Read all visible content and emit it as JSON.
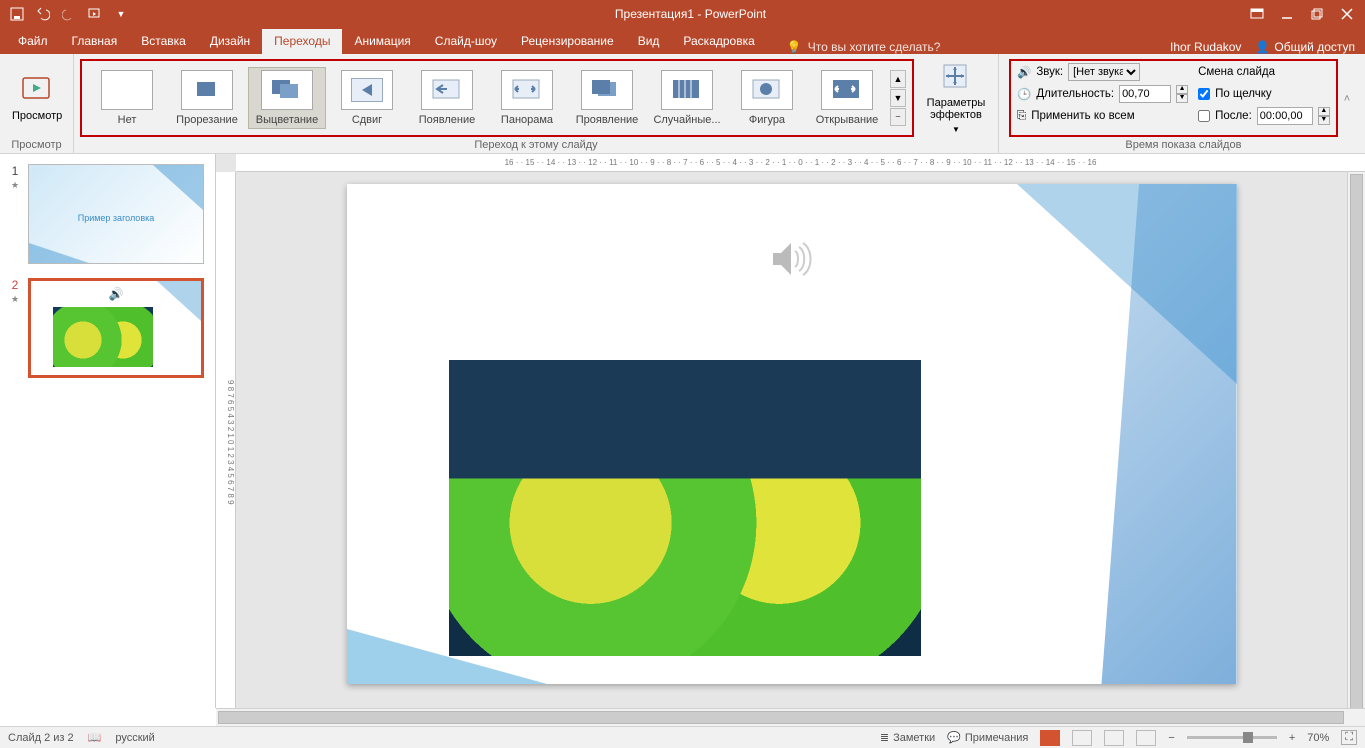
{
  "title": "Презентация1 - PowerPoint",
  "user": "Ihor Rudakov",
  "share": "Общий доступ",
  "tabs": [
    "Файл",
    "Главная",
    "Вставка",
    "Дизайн",
    "Переходы",
    "Анимация",
    "Слайд-шоу",
    "Рецензирование",
    "Вид",
    "Раскадровка"
  ],
  "active_tab": 4,
  "tell_me": "Что вы хотите сделать?",
  "groups": {
    "preview": "Просмотр",
    "preview_btn": "Просмотр",
    "transition": "Переход к этому слайду",
    "items": [
      "Нет",
      "Прорезание",
      "Выцветание",
      "Сдвиг",
      "Появление",
      "Панорама",
      "Проявление",
      "Случайные...",
      "Фигура",
      "Открывание"
    ],
    "selected_item": 2,
    "options": "Параметры эффектов",
    "timing": "Время показа слайдов",
    "sound_lbl": "Звук:",
    "sound_val": "[Нет звука]",
    "dur_lbl": "Длительность:",
    "dur_val": "00,70",
    "apply_all": "Применить ко всем",
    "advance_hdr": "Смена слайда",
    "onclick": "По щелчку",
    "after_lbl": "После:",
    "after_val": "00:00,00"
  },
  "thumb1_title": "Пример заголовка",
  "status": {
    "slide": "Слайд 2 из 2",
    "lang": "русский",
    "notes": "Заметки",
    "comments": "Примечания",
    "zoom": "70%"
  },
  "ruler_h": "16 · · 15 · · 14 · · 13 · · 12 · · 11 · · 10 · · 9 · · 8 · · 7 · · 6 · · 5 · · 4 · · 3 · · 2 · · 1 · · 0 · · 1 · · 2 · · 3 · · 4 · · 5 · · 6 · · 7 · · 8 · · 9 · · 10 · · 11 · · 12 · · 13 · · 14 · · 15 · · 16",
  "ruler_v": "9 8 7 6 5 4 3 2 1 0 1 2 3 4 5 6 7 8 9"
}
